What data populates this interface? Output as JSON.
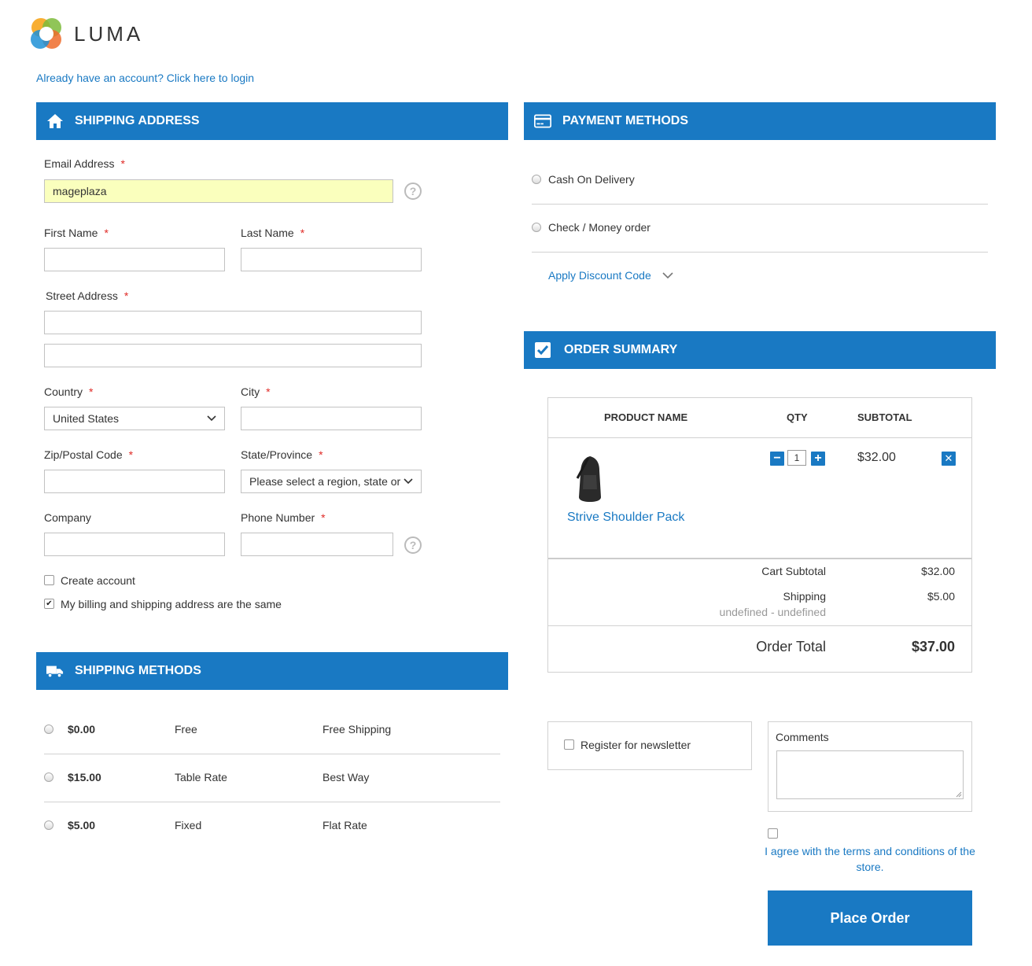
{
  "header": {
    "logo_text": "LUMA",
    "login_link": "Already have an account? Click here to login"
  },
  "shipping_address": {
    "title": "SHIPPING ADDRESS",
    "email_label": "Email Address",
    "email_value": "mageplaza",
    "first_name_label": "First Name",
    "last_name_label": "Last Name",
    "street_label": "Street Address",
    "country_label": "Country",
    "country_value": "United States",
    "city_label": "City",
    "zip_label": "Zip/Postal Code",
    "state_label": "State/Province",
    "state_value": "Please select a region, state or province.",
    "company_label": "Company",
    "phone_label": "Phone Number",
    "required_mark": "*",
    "help_mark": "?",
    "create_account": "Create account",
    "billing_same": "My billing and shipping address are the same"
  },
  "shipping_methods": {
    "title": "SHIPPING METHODS",
    "rows": [
      {
        "price": "$0.00",
        "method": "Free",
        "carrier": "Free Shipping"
      },
      {
        "price": "$15.00",
        "method": "Table Rate",
        "carrier": "Best Way"
      },
      {
        "price": "$5.00",
        "method": "Fixed",
        "carrier": "Flat Rate"
      }
    ]
  },
  "payment_methods": {
    "title": "PAYMENT METHODS",
    "options": [
      "Cash On Delivery",
      "Check / Money order"
    ],
    "discount_link": "Apply Discount Code"
  },
  "order_summary": {
    "title": "ORDER SUMMARY",
    "col_product": "PRODUCT NAME",
    "col_qty": "QTY",
    "col_subtotal": "SUBTOTAL",
    "item": {
      "name": "Strive Shoulder Pack",
      "qty": "1",
      "subtotal": "$32.00"
    },
    "cart_subtotal_label": "Cart Subtotal",
    "cart_subtotal_value": "$32.00",
    "shipping_label": "Shipping",
    "shipping_sub": "undefined - undefined",
    "shipping_value": "$5.00",
    "order_total_label": "Order Total",
    "order_total_value": "$37.00"
  },
  "extras": {
    "newsletter": "Register for newsletter",
    "comments_label": "Comments",
    "terms": "I agree with the terms and conditions of the store.",
    "place_order": "Place Order"
  },
  "colors": {
    "accent": "#1979c3",
    "required": "#e02b27",
    "autofill": "#faffbd"
  }
}
